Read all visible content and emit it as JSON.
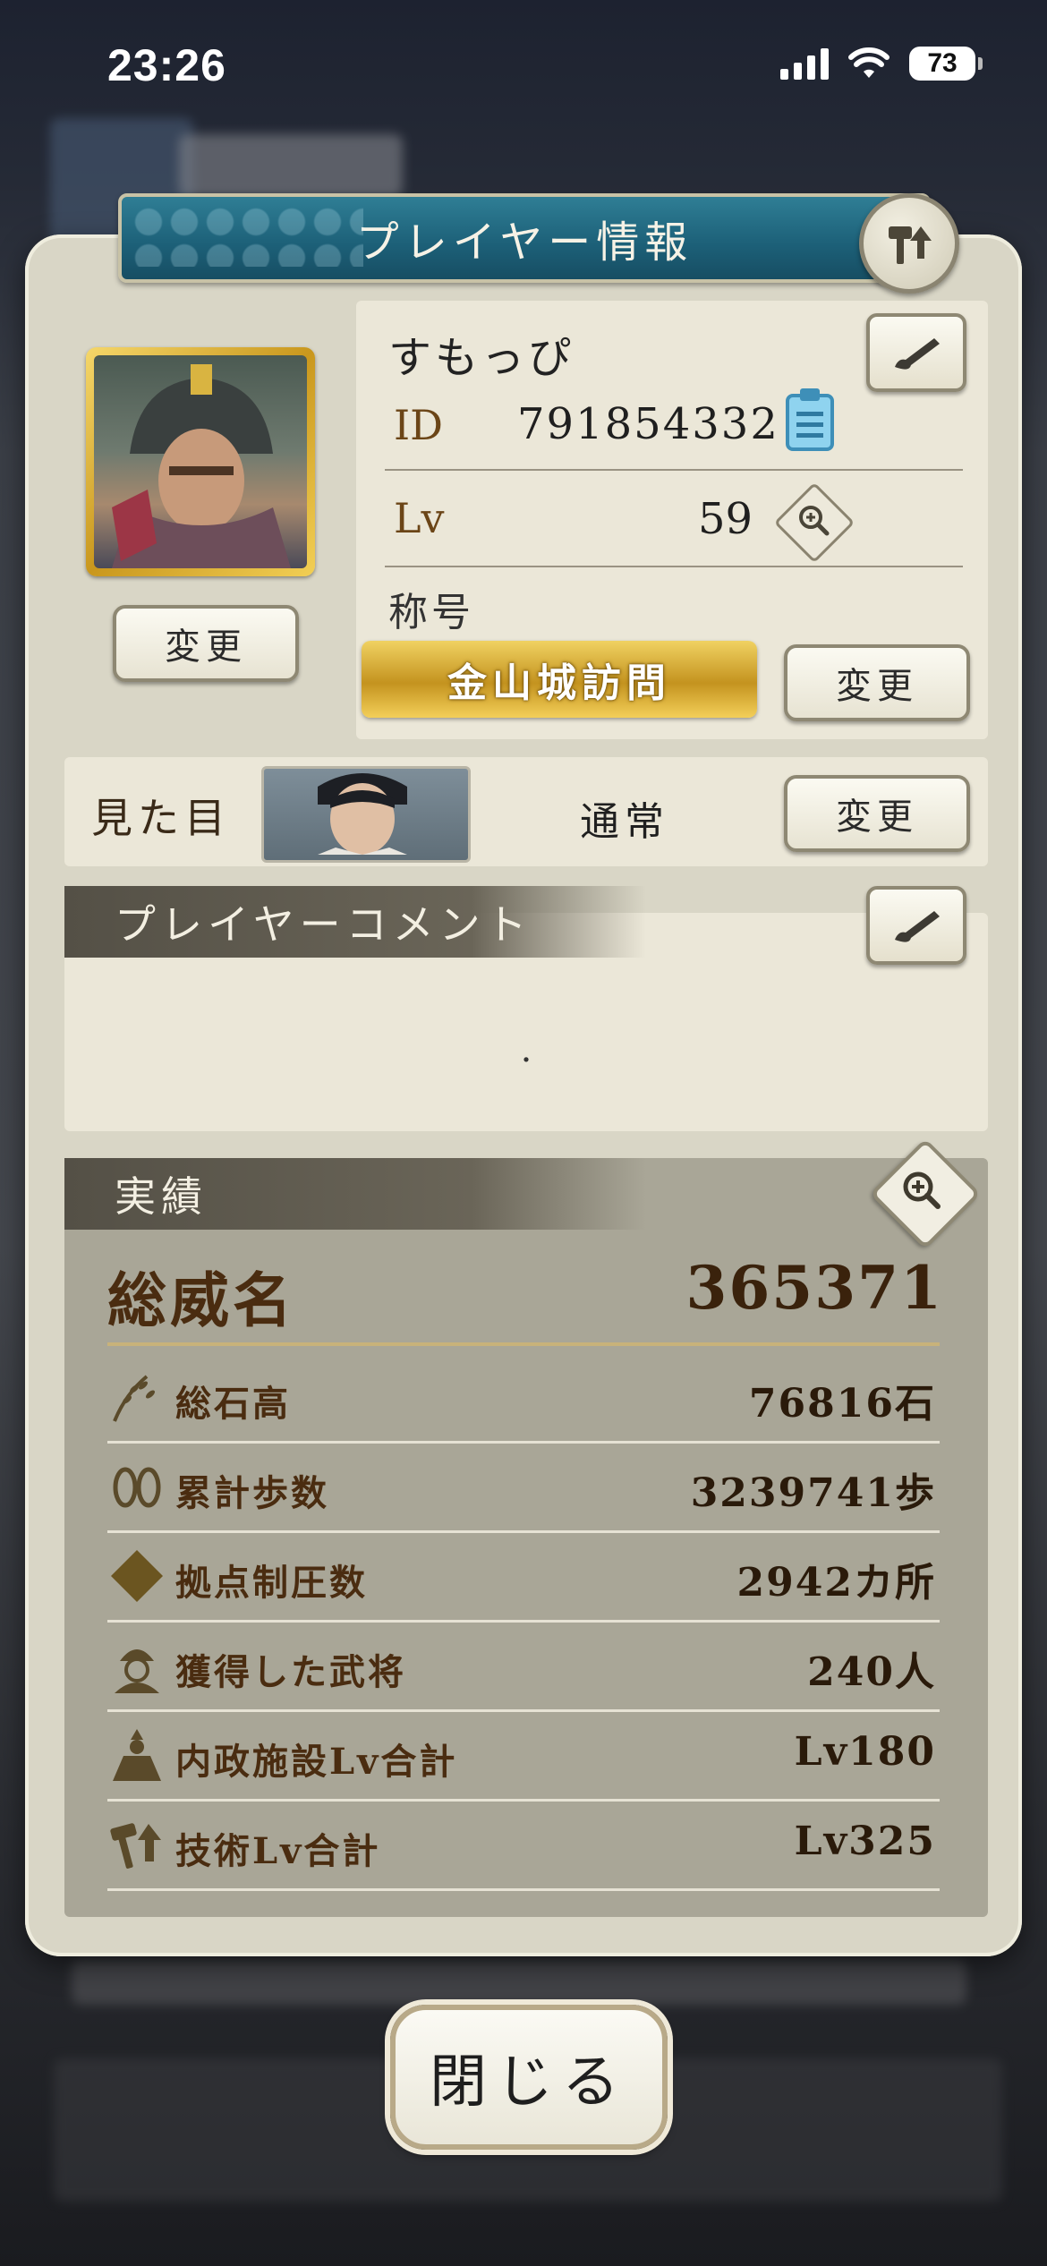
{
  "status_bar": {
    "time": "23:26",
    "battery": "73"
  },
  "dialog": {
    "title": "プレイヤー情報"
  },
  "profile": {
    "name": "すもっぴ",
    "id_label": "ID",
    "id_value": "791854332",
    "lv_label": "Lv",
    "lv_value": "59",
    "title_label": "称号",
    "title_value": "金山城訪問",
    "change_label": "変更"
  },
  "appearance": {
    "label": "見た目",
    "value": "通常",
    "change_label": "変更"
  },
  "comment": {
    "header": "プレイヤーコメント",
    "text": "."
  },
  "achievements": {
    "header": "実績",
    "total_label": "総威名",
    "total_value": "365371",
    "stats": [
      {
        "label": "総石高",
        "value": "76816石",
        "icon": "rice-icon"
      },
      {
        "label": "累計歩数",
        "value": "3239741歩",
        "icon": "footprints-icon"
      },
      {
        "label": "拠点制圧数",
        "value": "2942カ所",
        "icon": "diamond-icon"
      },
      {
        "label": "獲得した武将",
        "value": "240人",
        "icon": "warlord-icon"
      },
      {
        "label": "内政施設Lv合計",
        "value": "Lv180",
        "icon": "building-icon"
      },
      {
        "label": "技術Lv合計",
        "value": "Lv325",
        "icon": "hammer-icon"
      }
    ]
  },
  "close_label": "閉じる"
}
